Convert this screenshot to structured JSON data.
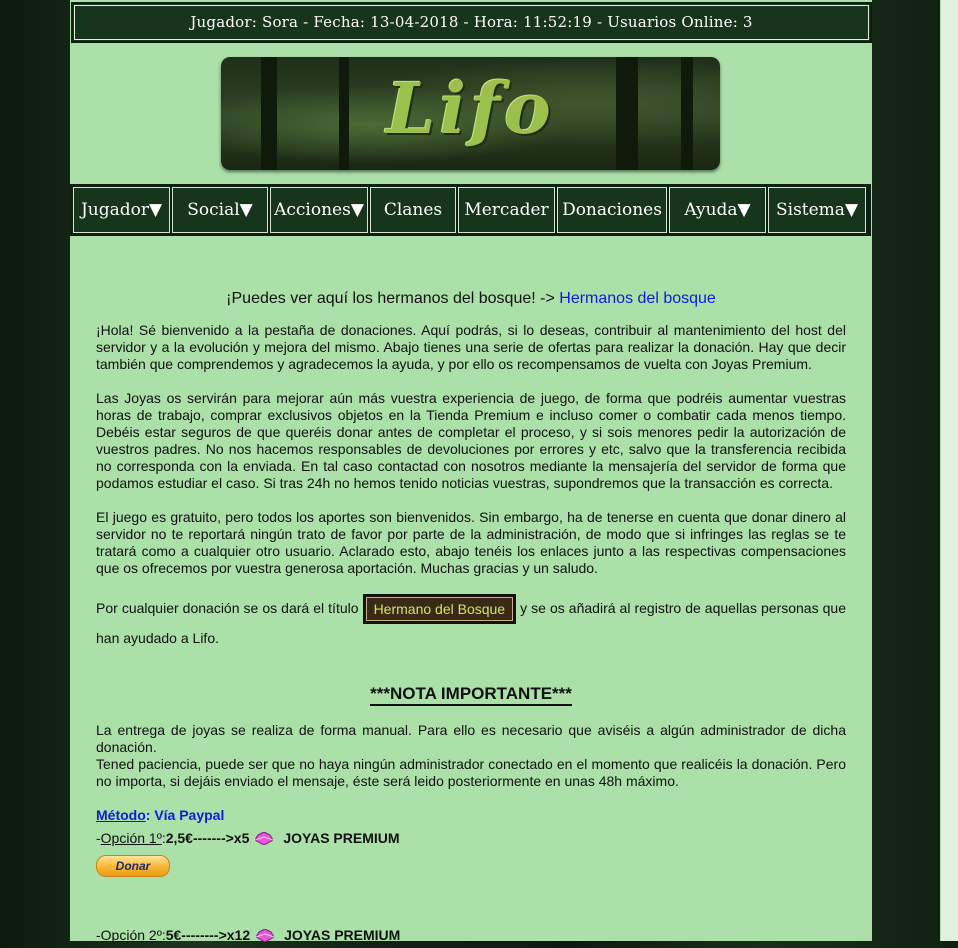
{
  "header": {
    "text": "Jugador: Sora - Fecha: 13-04-2018 - Hora: 11:52:19 - Usuarios Online: 3"
  },
  "banner": {
    "logo_text": "Lifo"
  },
  "menu": {
    "items": [
      {
        "label": "Jugador▼"
      },
      {
        "label": "Social▼"
      },
      {
        "label": "Acciones▼"
      },
      {
        "label": "Clanes"
      },
      {
        "label": "Mercader"
      },
      {
        "label": "Donaciones"
      },
      {
        "label": "Ayuda▼"
      },
      {
        "label": "Sistema▼"
      }
    ]
  },
  "content": {
    "headline_text": "¡Puedes ver aquí los hermanos del bosque! -> ",
    "headline_link": "Hermanos del bosque",
    "para1": "¡Hola! Sé bienvenido a la pestaña de donaciones. Aquí podrás, si lo deseas, contribuir al mantenimiento del host del servidor y a la evolución y mejora del mismo. Abajo tienes una serie de ofertas para realizar la donación. Hay que decir también que comprendemos y agradecemos la ayuda, y por ello os recompensamos de vuelta con Joyas Premium.",
    "para2": "Las Joyas os servirán para mejorar aún más vuestra experiencia de juego, de forma que podréis aumentar vuestras horas de trabajo, comprar exclusivos objetos en la Tienda Premium e incluso comer o combatir cada menos tiempo. Debéis estar seguros de que queréis donar antes de completar el proceso, y si sois menores pedir la autorización de vuestros padres. No nos hacemos responsables de devoluciones por errores y etc, salvo que la transferencia recibida no corresponda con la enviada. En tal caso contactad con nosotros mediante la mensajería del servidor de forma que podamos estudiar el caso. Si tras 24h no hemos tenido noticias vuestras, supondremos que la transacción es correcta.",
    "para3": "El juego es gratuito, pero todos los aportes son bienvenidos. Sin embargo, ha de tenerse en cuenta que donar dinero al servidor no te reportará ningún trato de favor por parte de la administración, de modo que si infringes las reglas se te tratará como a cualquier otro usuario. Aclarado esto, abajo tenéis los enlaces junto a las respectivas compensaciones que os ofrecemos por vuestra generosa aportación. Muchas gracias y un saludo.",
    "title_before": "Por cualquier donación se os dará el título ",
    "title_badge": "Hermano del Bosque",
    "title_after": " y se os añadirá al registro de aquellas personas que han ayudado a Lifo.",
    "nota": "***NOTA IMPORTANTE***",
    "entrega1": "La entrega de joyas se realiza de forma manual. Para ello es necesario que aviséis a algún administrador de dicha donación.",
    "entrega2": "Tened paciencia, puede ser que no haya ningún administrador conectado en el momento que realicéis la donación. Pero no importa, si dejáis enviado el mensaje, éste será leido posteriormente en unas 48h máximo.",
    "metodo_label": "Método",
    "metodo_value": ": Vía Paypal",
    "option1_prefix": "-",
    "option1_label": "Opción 1º",
    "option1_colon": ": ",
    "option1_amount": "2,5€------->x5",
    "option1_joyas": "JOYAS PREMIUM",
    "donar_label": "Donar",
    "option2_prefix": "-",
    "option2_label": "Opción 2º",
    "option2_colon": ": ",
    "option2_amount": "5€-------->x12",
    "option2_joyas": "JOYAS PREMIUM"
  },
  "colors": {
    "page_bg": "#abe0a8",
    "nav_bg": "#17351c",
    "link": "#0a1de0",
    "gem": "#e65ad8"
  }
}
